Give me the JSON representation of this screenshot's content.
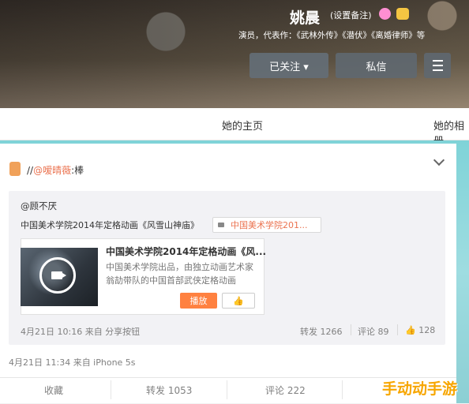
{
  "profile": {
    "name": "姚晨",
    "remark": "(设置备注)",
    "intro": "演员，代表作：《武林外传》《潜伏》《离婚律师》等",
    "follow_button": "已关注 ▾",
    "message_button": "私信"
  },
  "nav": {
    "tab_home": "她的主页",
    "tab_album": "她的相册"
  },
  "post": {
    "repost_prefix": "//",
    "repost_user": "@嗳晴薇",
    "repost_text": ":棒",
    "original": {
      "user": "@顾不厌",
      "text": "中国美术学院2014年定格动画《风雪山神庙》",
      "link_label": "中国美术学院201...",
      "video": {
        "title": "中国美术学院2014年定格动画《风...",
        "desc": "中国美术学院出品，由独立动画艺术家翁劼带队的中国首部武侠定格动画",
        "play_label": "播放",
        "like_label": "👍"
      },
      "time": "4月21日 10:16 来自 分享按钮",
      "repost_count": "转发 1266",
      "comment_count": "评论 89",
      "like_count": "128"
    },
    "repost_time": "4月21日 11:34 来自 iPhone 5s",
    "actions": {
      "favorite": "收藏",
      "repost": "转发 1053",
      "comment": "评论 222"
    }
  },
  "watermark": "手动动手游",
  "colors": {
    "accent_orange": "#eb7350",
    "play_orange": "#ff8140",
    "watermark": "#f7a600"
  }
}
